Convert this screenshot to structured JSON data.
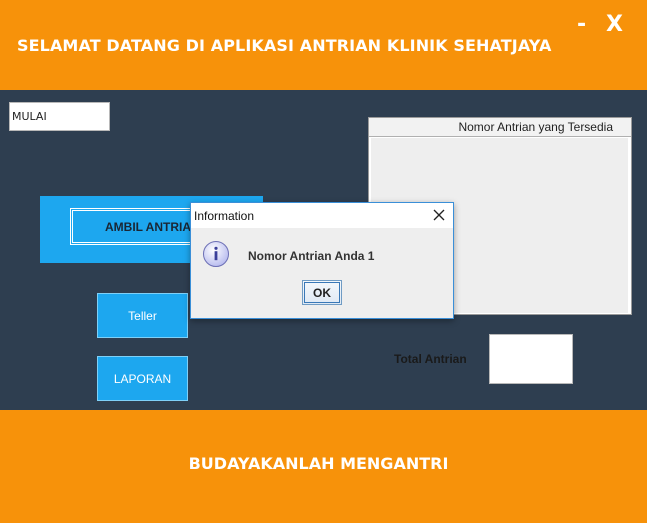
{
  "header": {
    "title": "SELAMAT DATANG DI APLIKASI ANTRIAN KLINIK SEHATJAYA",
    "minimize_label": "-",
    "close_label": "X"
  },
  "main": {
    "mulai_field_value": "MULAI",
    "ambil_button_label": "AMBIL ANTRIAN",
    "teller_button_label": "Teller",
    "laporan_button_label": "LAPORAN",
    "queue_table": {
      "column_header": "Nomor Antrian yang Tersedia",
      "rows": []
    },
    "total_label": "Total Antrian",
    "total_value": ""
  },
  "footer": {
    "slogan": "BUDAYAKANLAH MENGANTRI"
  },
  "dialog": {
    "title": "Information",
    "message": "Nomor Antrian Anda 1",
    "ok_label": "OK",
    "icon": "info-icon"
  },
  "colors": {
    "header_footer": "#f7920a",
    "body_background": "#2e3e50",
    "button_blue": "#1da7ef"
  }
}
